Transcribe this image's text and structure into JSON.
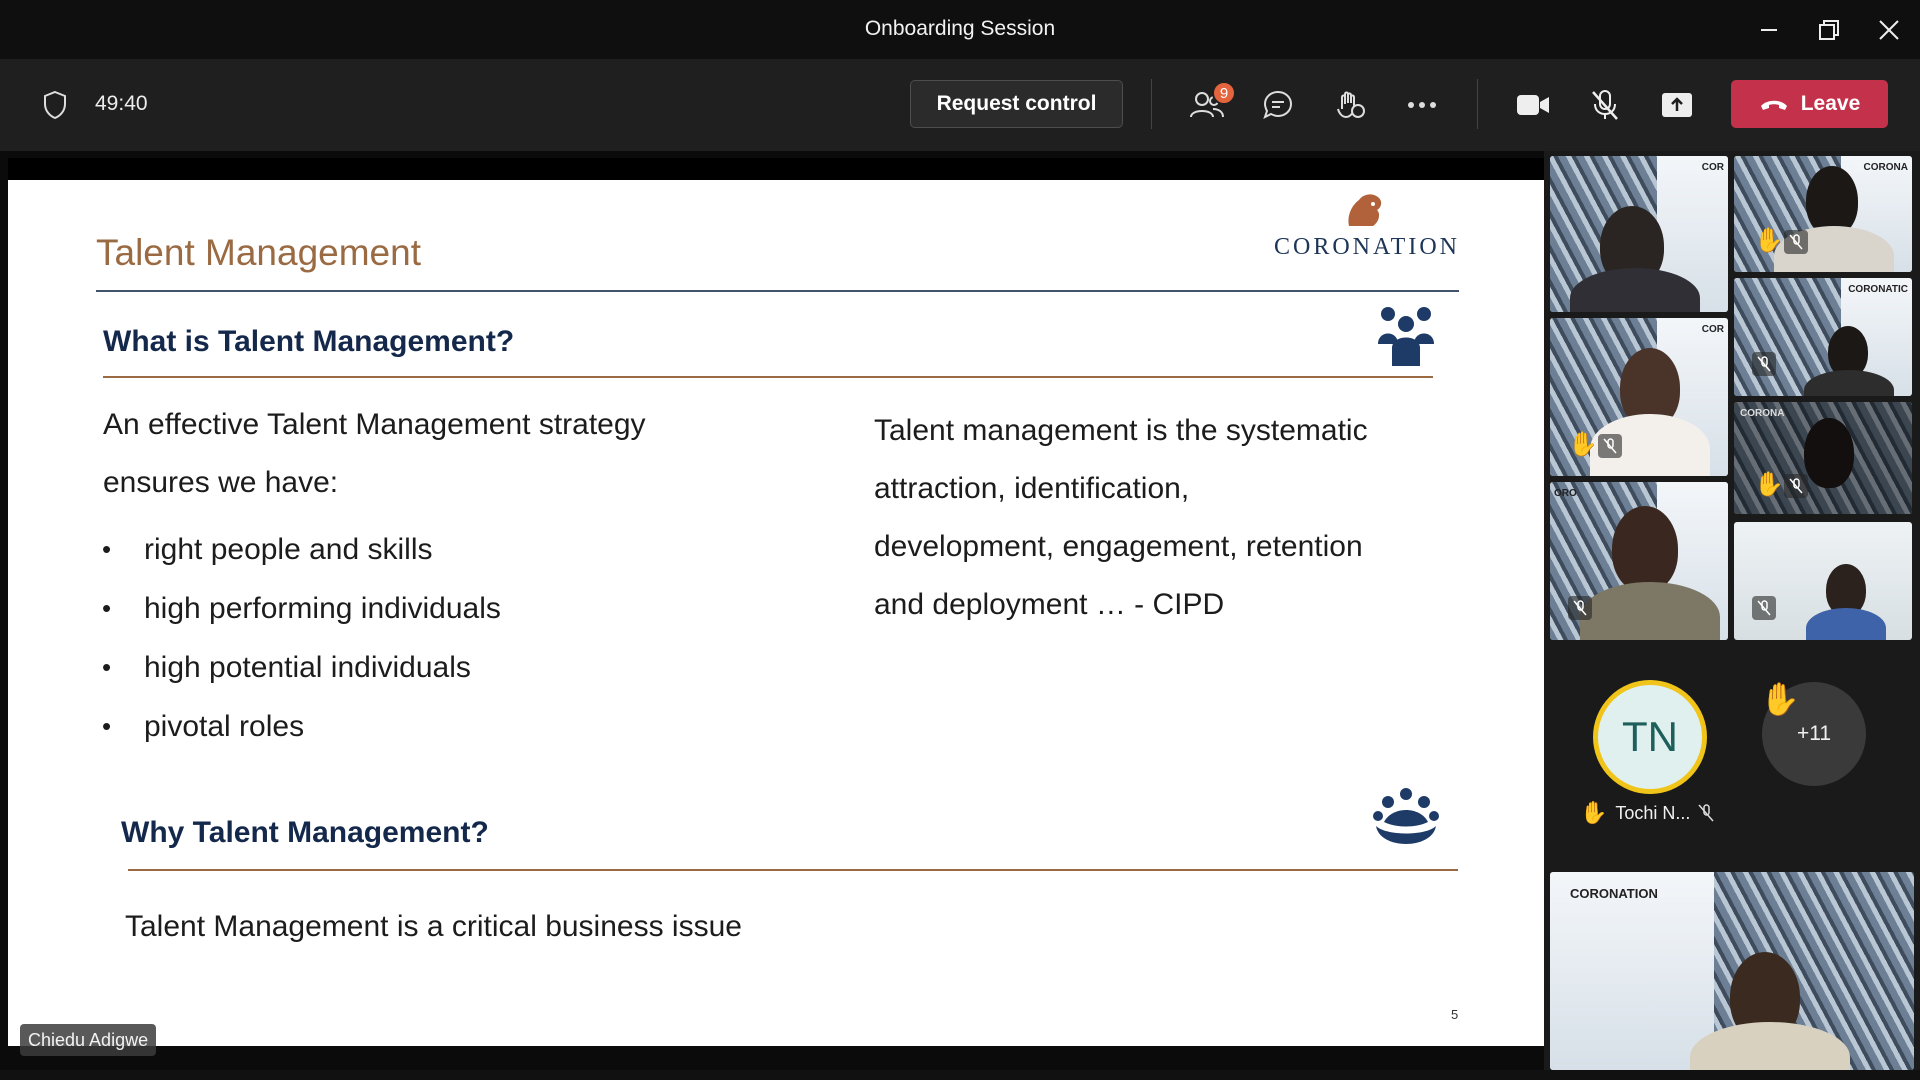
{
  "window": {
    "title": "Onboarding Session",
    "minimize_icon": "minimize-icon",
    "restore_icon": "restore-icon",
    "close_icon": "close-icon"
  },
  "toolbar": {
    "timer": "49:40",
    "request_control_label": "Request control",
    "participants_badge": "9",
    "leave_label": "Leave",
    "icons": [
      "shield-icon",
      "participants-icon",
      "chat-icon",
      "reactions-icon",
      "more-icon",
      "camera-icon",
      "mic-off-icon",
      "share-icon",
      "phone-icon"
    ],
    "colors": {
      "leave": "#c4314b",
      "badge": "#e3643d"
    }
  },
  "slide": {
    "title": "Talent Management",
    "logo_text": "CORONATION",
    "section1_heading": "What is Talent Management?",
    "intro_line1": "An effective Talent Management strategy",
    "intro_line2": "ensures we have:",
    "bullets": [
      "right people and skills",
      "high performing individuals",
      "high potential individuals",
      "pivotal roles"
    ],
    "quote_lines": [
      "Talent management is the systematic",
      "attraction, identification,",
      "development,  engagement, retention",
      "and deployment … -  CIPD"
    ],
    "section2_heading": "Why Talent Management?",
    "section2_body": "Talent Management is a critical business issue",
    "page_number": "5",
    "colors": {
      "title": "#9a6a42",
      "heading": "#14284b",
      "rule": "#9a6a42"
    }
  },
  "presenter_name": "Chiedu Adigwe",
  "gallery": {
    "tiles": [
      {
        "tag": "COR",
        "state": "active"
      },
      {
        "tag": "CORONA",
        "state": "raised"
      },
      {
        "tag": "CORONATIC",
        "state": "muted"
      },
      {
        "tag": "COR",
        "state": "raised"
      },
      {
        "tag": "CORONA",
        "state": "raised"
      },
      {
        "tag": "ORO",
        "state": "muted"
      },
      {
        "tag": "",
        "state": "muted"
      }
    ],
    "tn_initials": "TN",
    "tn_name": "Tochi N...",
    "more_count": "+11",
    "bottom_tag": "CORONATION"
  }
}
